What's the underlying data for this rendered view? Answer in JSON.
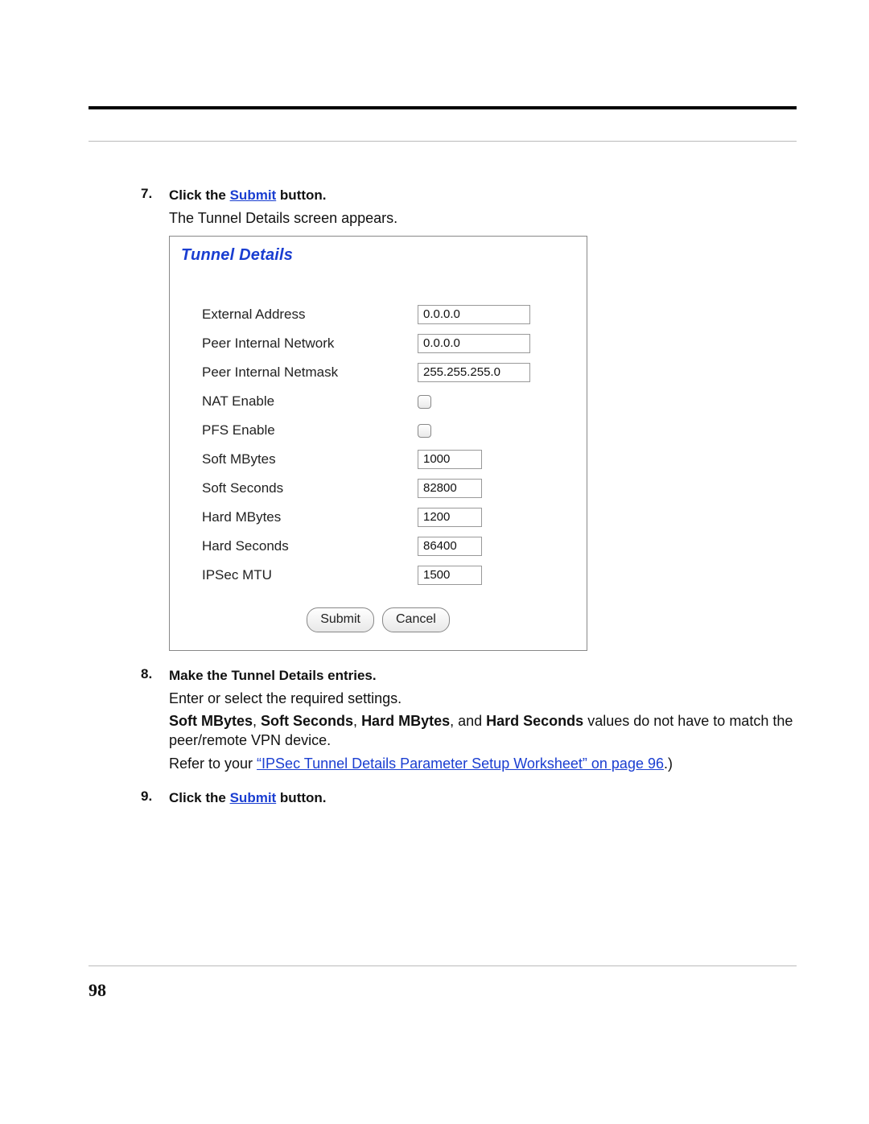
{
  "page_number": "98",
  "steps": {
    "s7": {
      "num": "7.",
      "head_prefix": "Click the ",
      "head_link": "Submit",
      "head_suffix": " button.",
      "body1": "The Tunnel Details screen appears."
    },
    "s8": {
      "num": "8.",
      "head": "Make the Tunnel Details entries.",
      "body1": "Enter or select the required settings.",
      "body2_b1": "Soft MBytes",
      "body2_sep1": ", ",
      "body2_b2": "Soft Seconds",
      "body2_sep2": ", ",
      "body2_b3": "Hard MBytes",
      "body2_sep3": ", and ",
      "body2_b4": "Hard Seconds",
      "body2_tail": " values do not have to match the peer/remote VPN device.",
      "body3_prefix": "Refer to your ",
      "body3_link": "“IPSec Tunnel Details Parameter Setup Worksheet” on page 96",
      "body3_suffix": ".)"
    },
    "s9": {
      "num": "9.",
      "head_prefix": "Click the ",
      "head_link": "Submit",
      "head_suffix": " button."
    }
  },
  "form": {
    "title": "Tunnel Details",
    "labels": {
      "external_address": "External Address",
      "peer_internal_network": "Peer Internal Network",
      "peer_internal_netmask": "Peer Internal Netmask",
      "nat_enable": "NAT Enable",
      "pfs_enable": "PFS Enable",
      "soft_mbytes": "Soft MBytes",
      "soft_seconds": "Soft Seconds",
      "hard_mbytes": "Hard MBytes",
      "hard_seconds": "Hard Seconds",
      "ipsec_mtu": "IPSec MTU"
    },
    "values": {
      "external_address": "0.0.0.0",
      "peer_internal_network": "0.0.0.0",
      "peer_internal_netmask": "255.255.255.0",
      "soft_mbytes": "1000",
      "soft_seconds": "82800",
      "hard_mbytes": "1200",
      "hard_seconds": "86400",
      "ipsec_mtu": "1500"
    },
    "buttons": {
      "submit": "Submit",
      "cancel": "Cancel"
    }
  }
}
